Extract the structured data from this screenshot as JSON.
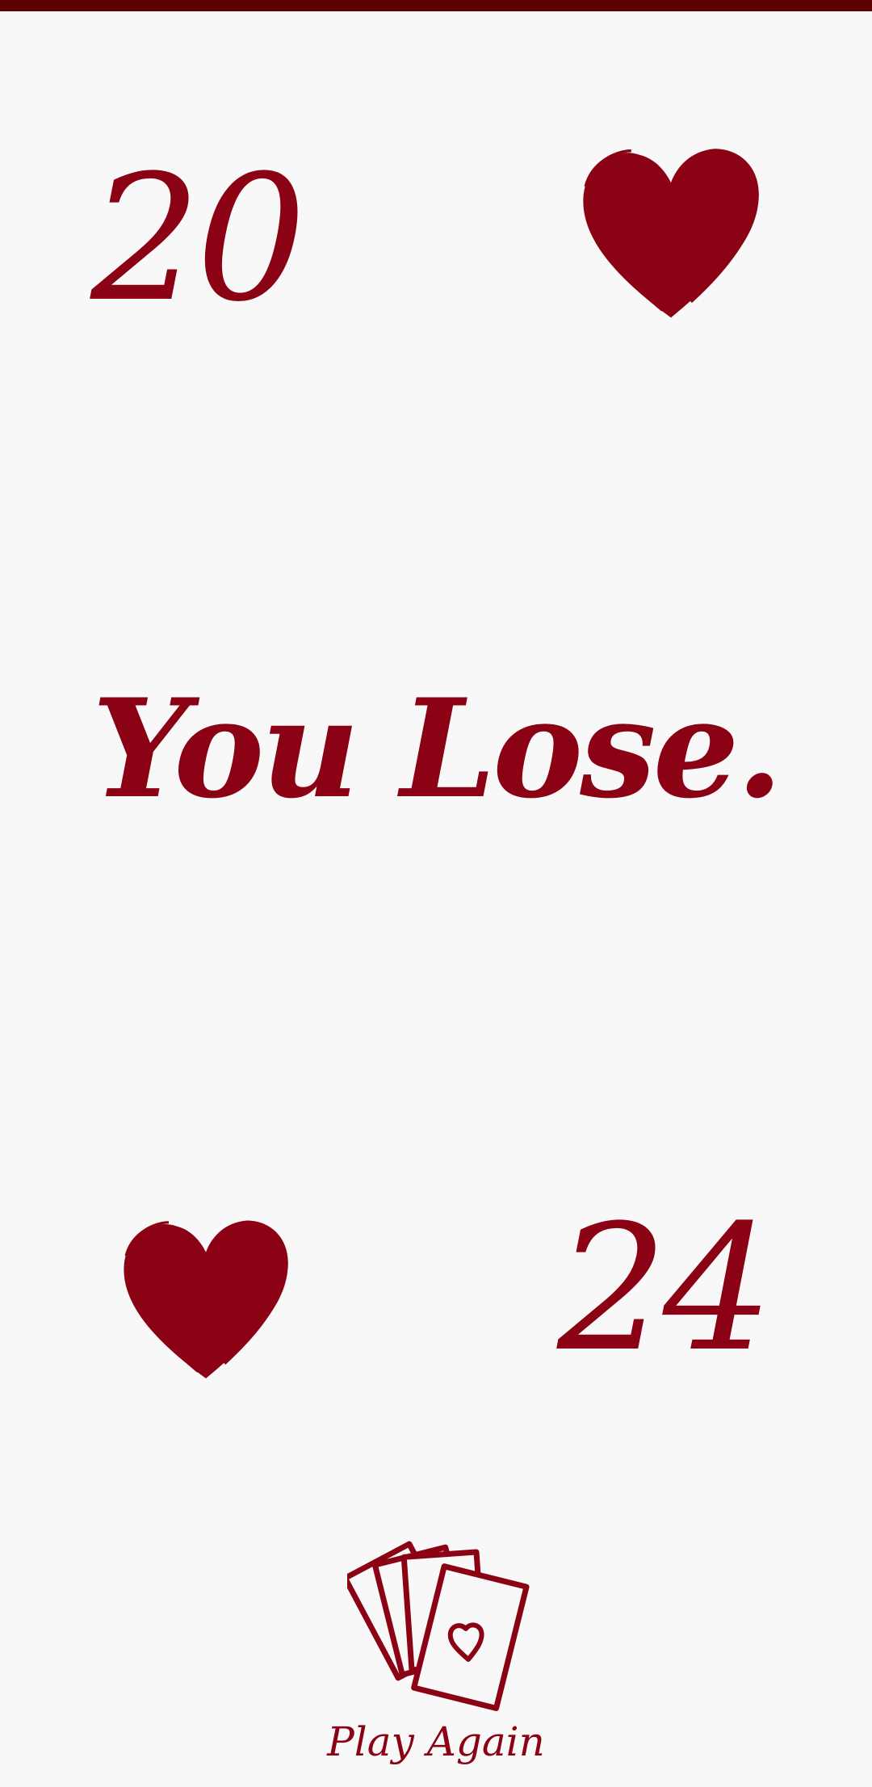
{
  "top_bar_color": "#5c0000",
  "accent_color": "#8b0215",
  "background_color": "#f8f8f8",
  "player_one": {
    "score": "20",
    "icon": "heart-icon"
  },
  "player_two": {
    "score": "24",
    "icon": "heart-icon"
  },
  "result_text": "You Lose.",
  "play_again": {
    "label": "Play Again",
    "icon": "playing-cards-icon"
  }
}
